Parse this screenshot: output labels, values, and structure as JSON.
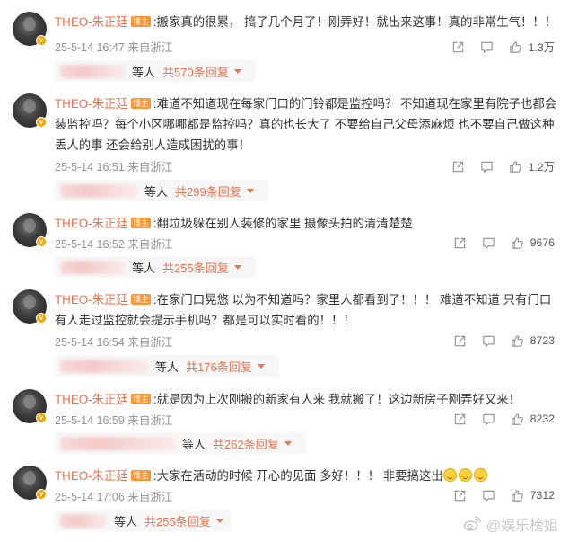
{
  "badge_text": "博主",
  "reply_word": "等人",
  "watermark": "@娱乐榜姐",
  "colors": {
    "author": "#eb7350",
    "badge": "#ff9431",
    "verified": "#f7a400",
    "meta": "#939393"
  },
  "icons": {
    "share": "share-icon",
    "comment": "comment-icon",
    "like": "thumbs-up-icon",
    "caret": "caret-down-icon",
    "verified": "verified-badge-icon"
  },
  "comments": [
    {
      "author": "THEO-朱正廷",
      "content": ":搬家真的很累， 搞了几个月了！刚弄好！就出来这事！真的非常生气！！！",
      "date": "25-5-14 16:47",
      "location": "来自浙江",
      "likes": "1.3万",
      "reply_count": "共570条回复"
    },
    {
      "author": "THEO-朱正廷",
      "content": ":难道不知道现在每家门口的门铃都是监控吗？ 不知道现在家里有院子也都会装监控吗？每个小区哪哪都是监控吗？真的也长大了 不要给自己父母添麻烦 也不要自己做这种丢人的事 还会给别人造成困扰的事！",
      "date": "25-5-14 16:51",
      "location": "来自浙江",
      "likes": "1.2万",
      "reply_count": "共299条回复"
    },
    {
      "author": "THEO-朱正廷",
      "content": ":翻垃圾躲在别人装修的家里 摄像头拍的清清楚楚",
      "date": "25-5-14 16:52",
      "location": "来自浙江",
      "likes": "9676",
      "reply_count": "共255条回复"
    },
    {
      "author": "THEO-朱正廷",
      "content": ":在家门口晃悠 以为不知道吗？家里人都看到了！！！ 难道不知道 只有门口有人走过监控就会提示手机吗？都是可以实时看的！！！",
      "date": "25-5-14 16:54",
      "location": "来自浙江",
      "likes": "8723",
      "reply_count": "共176条回复"
    },
    {
      "author": "THEO-朱正廷",
      "content": ":就是因为上次刚搬的新家有人来 我就搬了！这边新房子刚弄好又来！",
      "date": "25-5-14 16:59",
      "location": "来自浙江",
      "likes": "8232",
      "reply_count": "共262条回复"
    },
    {
      "author": "THEO-朱正廷",
      "content": ":大家在活动的时候 开心的见面 多好！！！ 非要搞这出",
      "emoji_count": 3,
      "date": "25-5-14 17:06",
      "location": "来自浙江",
      "likes": "7312",
      "reply_count": "共255条回复"
    }
  ]
}
